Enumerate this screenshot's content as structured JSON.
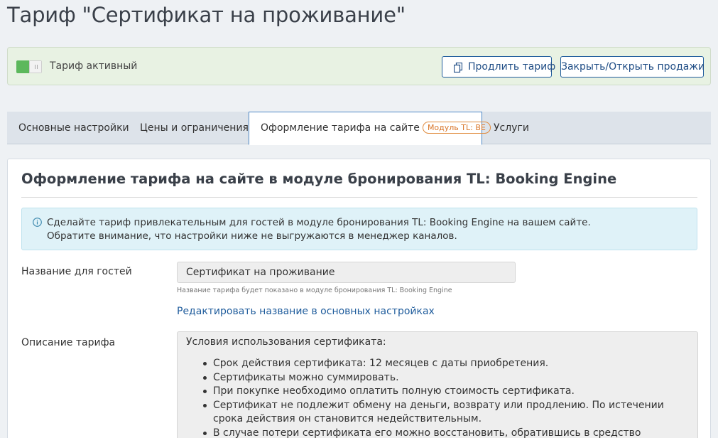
{
  "page": {
    "title": "Тариф \"Сертификат на проживание\""
  },
  "status": {
    "toggle_on": true,
    "toggle_label": "Тариф активный",
    "extend_button": "Продлить тариф",
    "sales_button": "Закрыть/Открыть продажи"
  },
  "tabs": [
    {
      "label": "Основные настройки"
    },
    {
      "label": "Цены и ограничения"
    },
    {
      "label": "Оформление тарифа на сайте",
      "badge": "Модуль TL: BE",
      "active": true
    },
    {
      "label": "Услуги"
    }
  ],
  "section": {
    "title": "Оформление тарифа на сайте в модуле бронирования TL: Booking Engine",
    "info_line1": "Сделайте тариф привлекательным для гостей в модуле бронирования TL: Booking Engine на вашем сайте.",
    "info_line2": "Обратите внимание, что настройки ниже не выгружаются в менеджер каналов."
  },
  "form": {
    "name_label": "Название для гостей",
    "name_value": "Сертификат на проживание",
    "name_hint": "Название тарифа будет показано в модуле бронирования TL: Booking Engine",
    "edit_link": "Редактировать название в основных настройках",
    "description_label": "Описание тарифа",
    "description_heading": "Условия использования сертификата:",
    "description_items": [
      "Срок действия сертификата: 12 месяцев с даты приобретения.",
      "Сертификаты можно суммировать.",
      "При покупке необходимо оплатить полную стоимость сертификата.",
      "Сертификат не подлежит обмену на деньги, возврату или продлению. По истечении срока действия он становится недействительным.",
      "В случае потери сертификата его можно восстановить, обратившись в средство размещения."
    ]
  },
  "colors": {
    "accent": "#1f5c9c",
    "toggle_on": "#5cb85c",
    "badge": "#e08a3c",
    "info_bg": "#dff2f8",
    "status_bg": "#e8f2e3"
  }
}
